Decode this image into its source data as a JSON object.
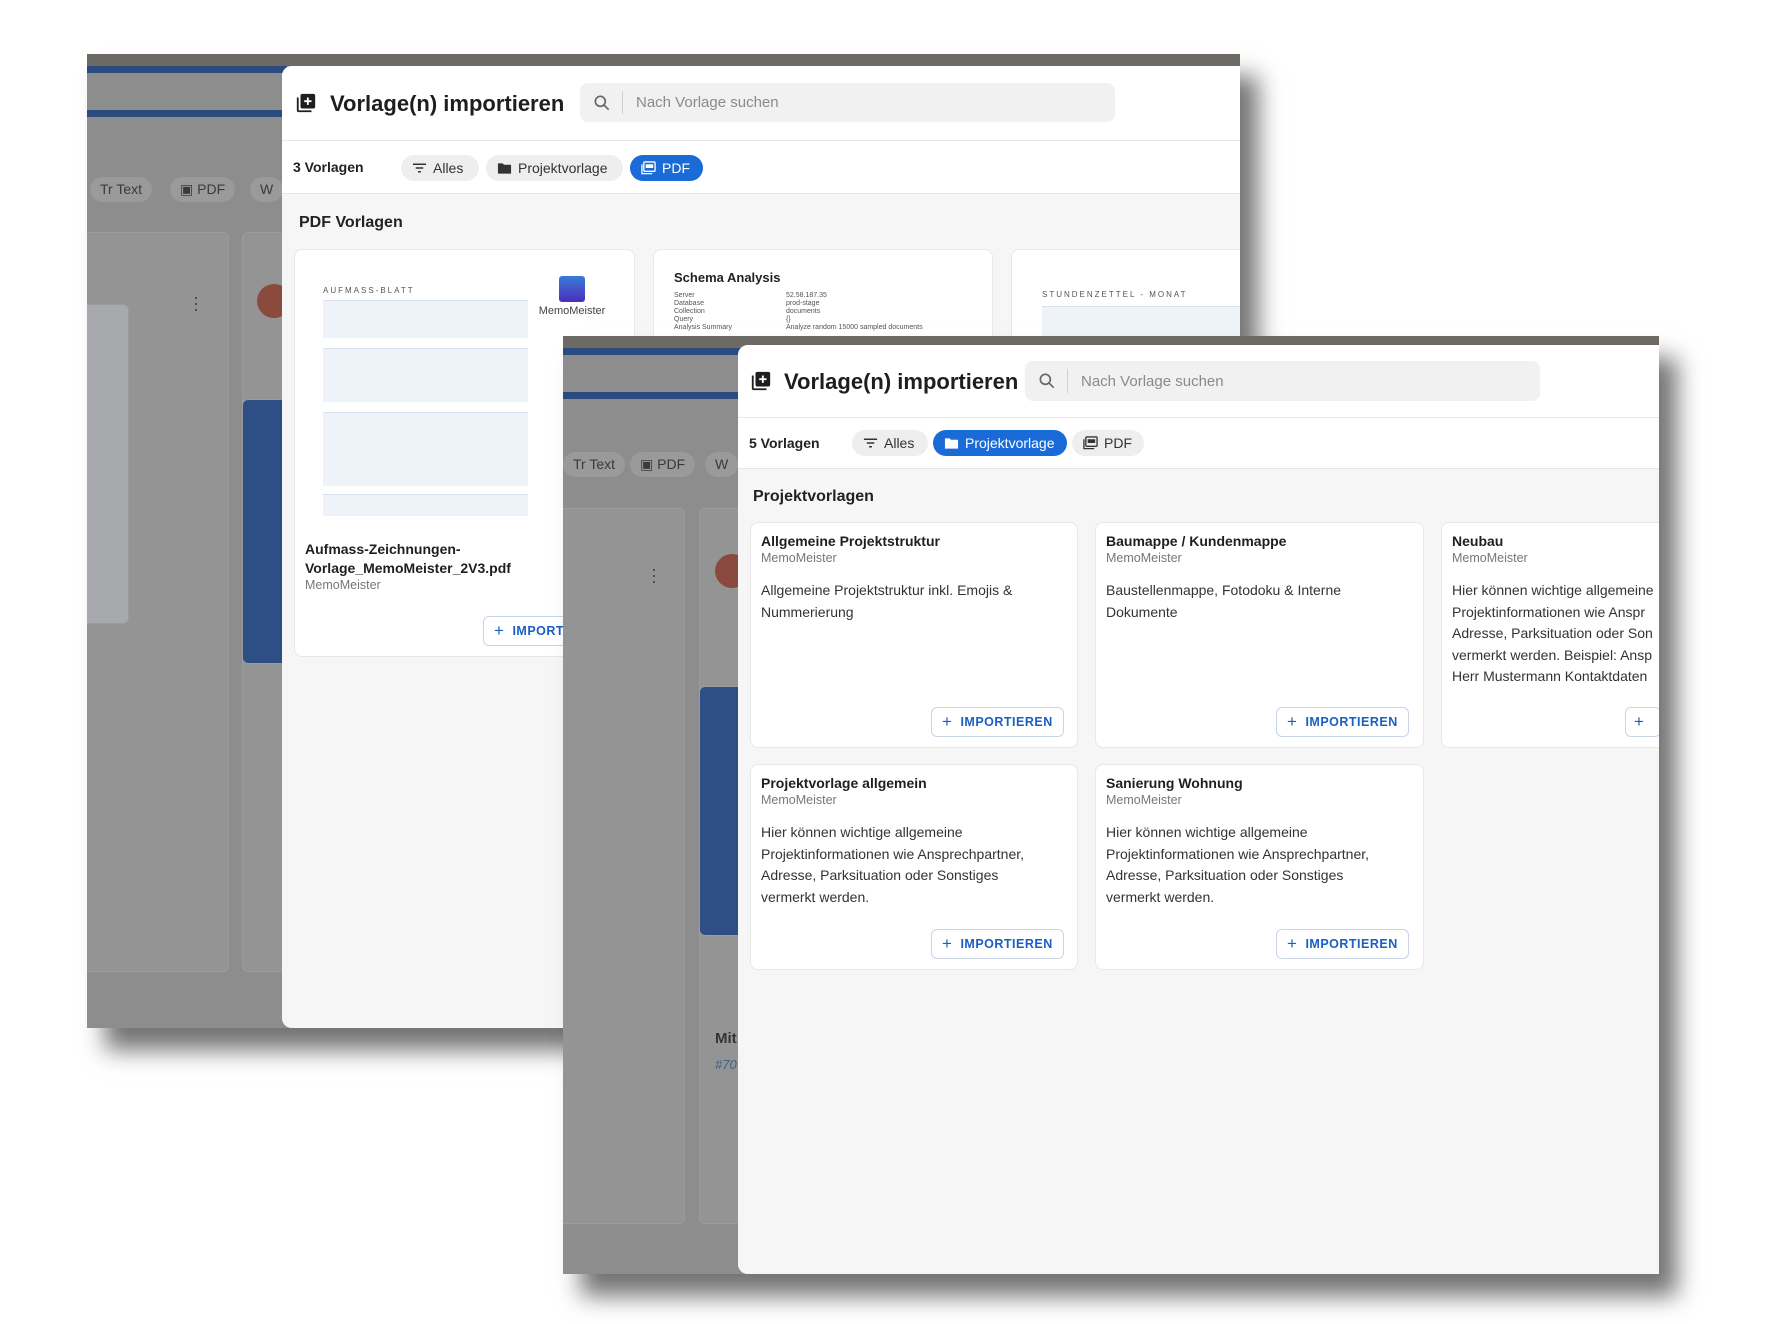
{
  "colors": {
    "accent": "#1a6ad8",
    "button_text": "#1a5fc4",
    "overlay": "#8d8d8d",
    "content_bg": "#f6f6f6"
  },
  "back_window": {
    "background": {
      "chips": [
        "Text",
        "PDF",
        "W"
      ],
      "chip_icons": [
        "text-format-icon",
        "pdf-icon",
        "word-icon"
      ]
    },
    "dialog": {
      "icon": "library-add-icon",
      "title": "Vorlage(n) importieren",
      "search": {
        "placeholder": "Nach Vorlage suchen",
        "value": ""
      },
      "count": "3 Vorlagen",
      "filters": [
        {
          "label": "Alles",
          "icon": "filter-icon",
          "active": false
        },
        {
          "label": "Projektvorlage",
          "icon": "folder-icon",
          "active": false
        },
        {
          "label": "PDF",
          "icon": "pdf-icon",
          "active": true
        }
      ],
      "section_title": "PDF Vorlagen",
      "cards": [
        {
          "title_lines": [
            "Aufmass-Zeichnungen-",
            "Vorlage_MemoMeister_2V3.pdf"
          ],
          "author": "MemoMeister",
          "button": "IMPORTIEREN",
          "thumb_heading": "AUFMASS-BLATT",
          "thumb_logo": "MemoMeister"
        },
        {
          "thumb_heading": "Schema Analysis",
          "thumb_rows": [
            {
              "k": "Server",
              "v": "52.58.187.35"
            },
            {
              "k": "Database",
              "v": "prod-stage"
            },
            {
              "k": "Collection",
              "v": "documents"
            },
            {
              "k": "Query",
              "v": "{}"
            },
            {
              "k": "Analysis Summary",
              "v": "Analyze random 15000 sampled documents"
            }
          ]
        },
        {
          "thumb_heading": "STUNDENZETTEL - MONAT"
        }
      ]
    }
  },
  "front_window": {
    "background": {
      "chips": [
        "Text",
        "PDF",
        "W"
      ],
      "texts": [
        "Mit",
        "#70"
      ]
    },
    "dialog": {
      "icon": "library-add-icon",
      "title": "Vorlage(n) importieren",
      "search": {
        "placeholder": "Nach Vorlage suchen",
        "value": ""
      },
      "count": "5 Vorlagen",
      "filters": [
        {
          "label": "Alles",
          "icon": "filter-icon",
          "active": false
        },
        {
          "label": "Projektvorlage",
          "icon": "folder-icon",
          "active": true
        },
        {
          "label": "PDF",
          "icon": "pdf-icon",
          "active": false
        }
      ],
      "section_title": "Projektvorlagen",
      "cards": [
        {
          "title": "Allgemeine Projektstruktur",
          "author": "MemoMeister",
          "desc_lines": [
            "Allgemeine Projektstruktur inkl. Emojis &",
            "Nummerierung"
          ],
          "button": "IMPORTIEREN"
        },
        {
          "title": "Baumappe / Kundenmappe",
          "author": "MemoMeister",
          "desc_lines": [
            "Baustellenmappe, Fotodoku & Interne",
            "Dokumente"
          ],
          "button": "IMPORTIEREN"
        },
        {
          "title": "Neubau",
          "author": "MemoMeister",
          "desc_lines": [
            "Hier können wichtige allgemeine",
            "Projektinformationen wie Anspr",
            "Adresse, Parksituation oder Son",
            "vermerkt werden. Beispiel: Ansp",
            "Herr Mustermann Kontaktdaten"
          ],
          "button": ""
        },
        {
          "title": "Projektvorlage allgemein",
          "author": "MemoMeister",
          "desc_lines": [
            "Hier können wichtige allgemeine",
            "Projektinformationen wie Ansprechpartner,",
            "Adresse, Parksituation oder Sonstiges",
            "vermerkt werden."
          ],
          "button": "IMPORTIEREN"
        },
        {
          "title": "Sanierung Wohnung",
          "author": "MemoMeister",
          "desc_lines": [
            "Hier können wichtige allgemeine",
            "Projektinformationen wie Ansprechpartner,",
            "Adresse, Parksituation oder Sonstiges",
            "vermerkt werden."
          ],
          "button": "IMPORTIEREN"
        }
      ]
    }
  }
}
